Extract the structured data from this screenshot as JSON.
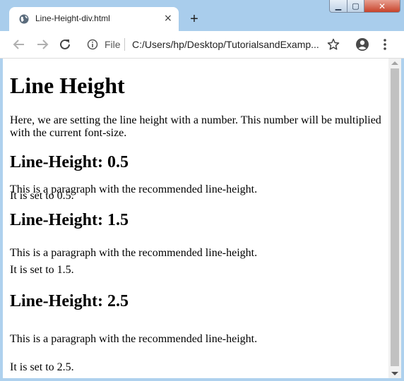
{
  "window": {
    "minimize_label": "▁",
    "maximize_label": "▢",
    "close_label": "✕"
  },
  "tab": {
    "title": "Line-Height-div.html",
    "close_label": "×"
  },
  "new_tab_label": "+",
  "address_bar": {
    "scheme_label": "File",
    "url": "C:/Users/hp/Desktop/TutorialsandExamp..."
  },
  "page": {
    "heading": "Line Height",
    "intro": "Here, we are setting the line height with a number. This number will be multiplied with the current font-size.",
    "sections": [
      {
        "heading": "Line-Height: 0.5",
        "line1": "This is a paragraph with the recommended line-height.",
        "line2": "It is set to 0.5."
      },
      {
        "heading": "Line-Height: 1.5",
        "line1": "This is a paragraph with the recommended line-height.",
        "line2": "It is set to 1.5."
      },
      {
        "heading": "Line-Height: 2.5",
        "line1": "This is a paragraph with the recommended line-height.",
        "line2": "It is set to 2.5."
      }
    ]
  },
  "colors": {
    "frame": "#aed1ee",
    "toolbar": "#ffffff",
    "close_button": "#c7432b",
    "scroll_thumb": "#c1c1c1"
  },
  "icons": {
    "tab_favicon": "globe-icon",
    "back": "back-arrow-icon",
    "forward": "forward-arrow-icon",
    "reload": "reload-icon",
    "info": "info-icon",
    "bookmark": "star-icon",
    "account": "account-icon",
    "menu": "kebab-menu-icon"
  }
}
